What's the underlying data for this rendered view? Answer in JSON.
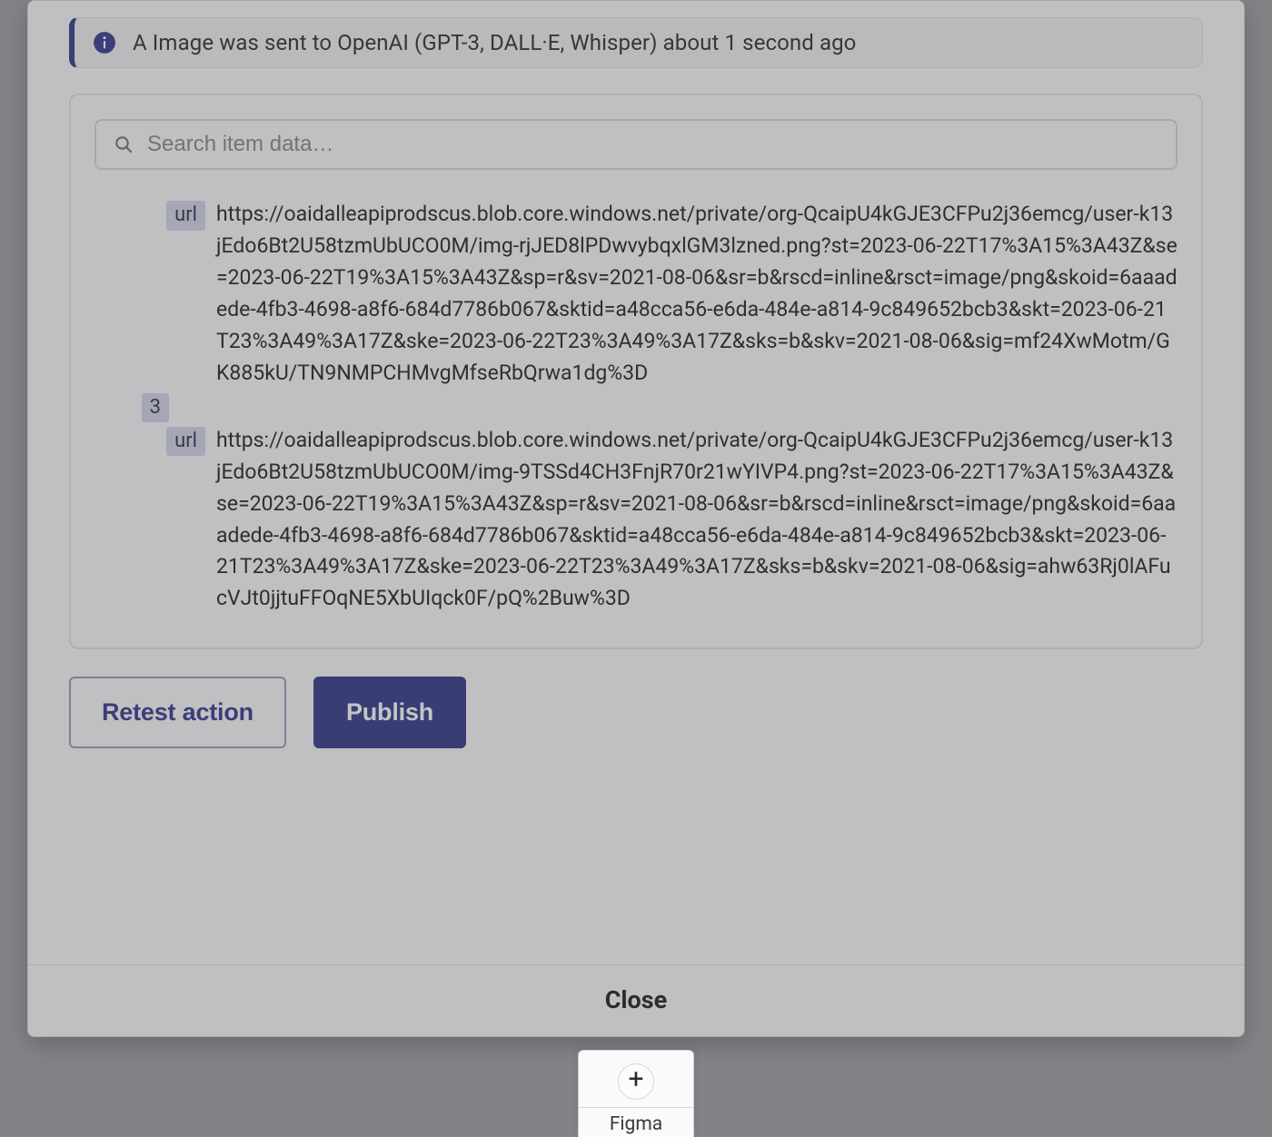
{
  "alert": {
    "message": "A Image was sent to OpenAI (GPT-3, DALL·E, Whisper) about 1 second ago"
  },
  "search": {
    "placeholder": "Search item data…"
  },
  "items": [
    {
      "key": "url",
      "value": "https://oaidalleapiprodscus.blob.core.windows.net/private/org-QcaipU4kGJE3CFPu2j36emcg/user-k13jEdo6Bt2U58tzmUbUCO0M/img-rjJED8lPDwvybqxlGM3lzned.png?st=2023-06-22T17%3A15%3A43Z&se=2023-06-22T19%3A15%3A43Z&sp=r&sv=2021-08-06&sr=b&rscd=inline&rsct=image/png&skoid=6aaadede-4fb3-4698-a8f6-684d7786b067&sktid=a48cca56-e6da-484e-a814-9c849652bcb3&skt=2023-06-21T23%3A49%3A17Z&ske=2023-06-22T23%3A49%3A17Z&sks=b&skv=2021-08-06&sig=mf24XwMotm/GK885kU/TN9NMPCHMvgMfseRbQrwa1dg%3D"
    },
    {
      "index": "3",
      "key": "url",
      "value": "https://oaidalleapiprodscus.blob.core.windows.net/private/org-QcaipU4kGJE3CFPu2j36emcg/user-k13jEdo6Bt2U58tzmUbUCO0M/img-9TSSd4CH3FnjR70r21wYIVP4.png?st=2023-06-22T17%3A15%3A43Z&se=2023-06-22T19%3A15%3A43Z&sp=r&sv=2021-08-06&sr=b&rscd=inline&rsct=image/png&skoid=6aaadede-4fb3-4698-a8f6-684d7786b067&sktid=a48cca56-e6da-484e-a814-9c849652bcb3&skt=2023-06-21T23%3A49%3A17Z&ske=2023-06-22T23%3A49%3A17Z&sks=b&skv=2021-08-06&sig=ahw63Rj0lAFucVJt0jjtuFFOqNE5XbUIqck0F/pQ%2Buw%3D"
    }
  ],
  "buttons": {
    "retest": "Retest action",
    "publish": "Publish",
    "close": "Close"
  },
  "dock": {
    "label": "Figma"
  }
}
